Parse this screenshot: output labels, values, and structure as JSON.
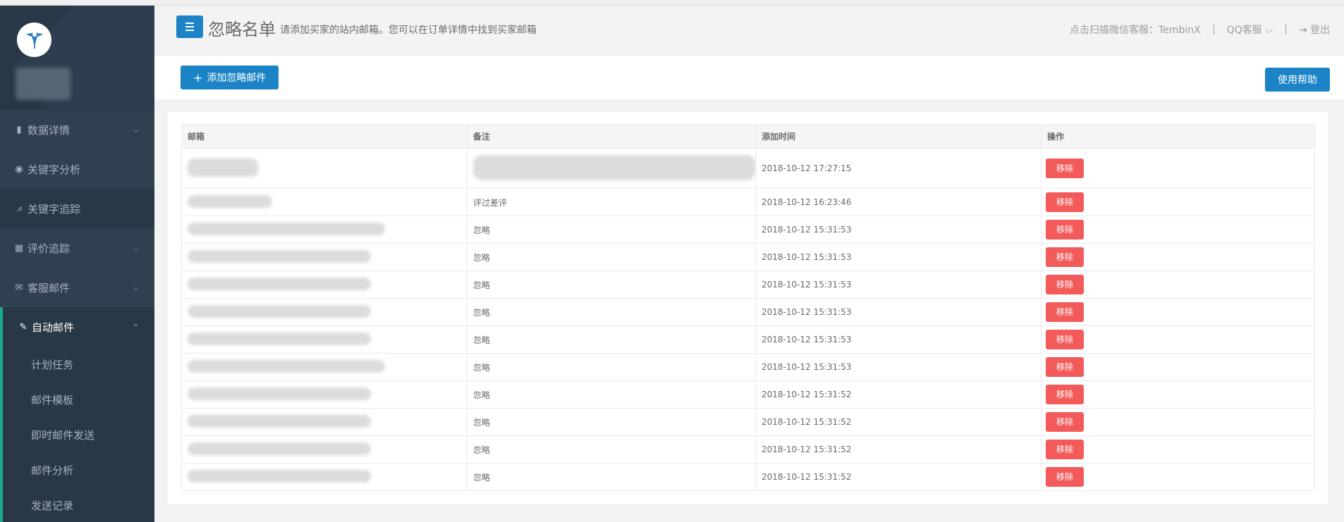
{
  "header": {
    "title": "忽略名单",
    "subtitle": "请添加买家的站内邮箱。您可以在订单详情中找到买家邮箱",
    "wechat_service": "点击扫描微信客服：TembinX",
    "qq_service": "QQ客服",
    "logout": "登出"
  },
  "sidebar": {
    "items": [
      {
        "label": "数据详情",
        "icon": "bar-chart-icon"
      },
      {
        "label": "关键字分析",
        "icon": "bullseye-icon"
      },
      {
        "label": "关键字追踪",
        "icon": "line-chart-icon"
      },
      {
        "label": "评价追踪",
        "icon": "table-icon"
      },
      {
        "label": "客服邮件",
        "icon": "envelope-icon"
      },
      {
        "label": "自动邮件",
        "icon": "edit-icon"
      }
    ],
    "sub_items": [
      {
        "label": "计划任务"
      },
      {
        "label": "邮件模板"
      },
      {
        "label": "即时邮件发送"
      },
      {
        "label": "邮件分析"
      },
      {
        "label": "发送记录"
      }
    ]
  },
  "toolbar": {
    "add_label": "添加忽略邮件",
    "help_label": "使用帮助"
  },
  "table": {
    "columns": [
      "邮箱",
      "备注",
      "添加时间",
      "操作"
    ],
    "remove_label": "移除",
    "rows": [
      {
        "note": "",
        "time": "2018-10-12 17:27:15"
      },
      {
        "note": "评过差评",
        "time": "2018-10-12 16:23:46"
      },
      {
        "note": "忽略",
        "time": "2018-10-12 15:31:53"
      },
      {
        "note": "忽略",
        "time": "2018-10-12 15:31:53"
      },
      {
        "note": "忽略",
        "time": "2018-10-12 15:31:53"
      },
      {
        "note": "忽略",
        "time": "2018-10-12 15:31:53"
      },
      {
        "note": "忽略",
        "time": "2018-10-12 15:31:53"
      },
      {
        "note": "忽略",
        "time": "2018-10-12 15:31:53"
      },
      {
        "note": "忽略",
        "time": "2018-10-12 15:31:52"
      },
      {
        "note": "忽略",
        "time": "2018-10-12 15:31:52"
      },
      {
        "note": "忽略",
        "time": "2018-10-12 15:31:52"
      },
      {
        "note": "忽略",
        "time": "2018-10-12 15:31:52"
      }
    ]
  }
}
